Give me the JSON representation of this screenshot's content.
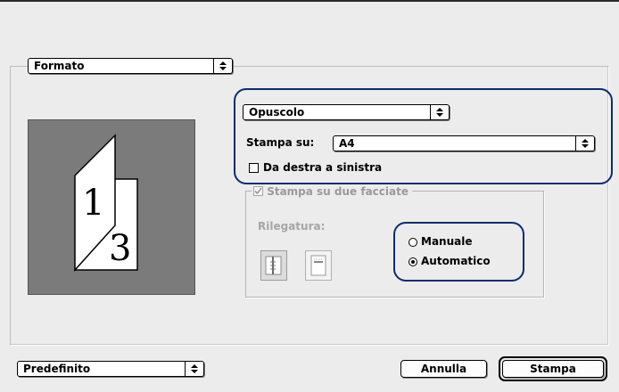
{
  "header": {
    "section_select": {
      "value": "Formato"
    }
  },
  "layout": {
    "type_select": {
      "value": "Opuscolo"
    },
    "paper_label": "Stampa su:",
    "paper_select": {
      "value": "A4"
    },
    "rtl_checkbox": {
      "label": "Da destra a sinistra",
      "checked": false
    }
  },
  "duplex": {
    "title": "Stampa su due facciate",
    "checked": true,
    "binding_label": "Rilegatura:",
    "mode_options": [
      {
        "label": "Manuale",
        "selected": false
      },
      {
        "label": "Automatico",
        "selected": true
      }
    ]
  },
  "preview": {
    "page_front": "1",
    "page_back": "3"
  },
  "footer": {
    "preset_select": {
      "value": "Predefinito"
    },
    "cancel_label": "Annulla",
    "print_label": "Stampa"
  },
  "colors": {
    "highlight_outline": "#0b2d6e",
    "preview_bg": "#7b7b7b"
  }
}
